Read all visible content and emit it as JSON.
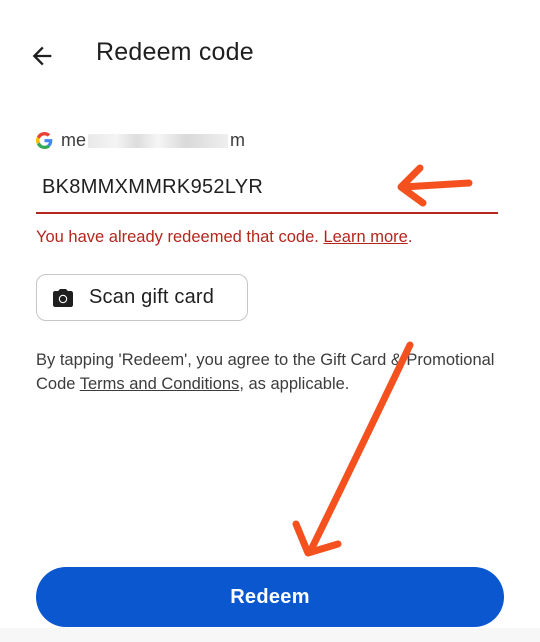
{
  "header": {
    "title": "Redeem code",
    "back_icon": "arrow-back-icon"
  },
  "account": {
    "email_prefix": "me",
    "email_suffix": "m",
    "logo": "google-g-icon"
  },
  "code_field": {
    "value": "BK8MMXMMRK952LYR",
    "underline_color": "#b3261e"
  },
  "error": {
    "message": "You have already redeemed that code. ",
    "link_label": "Learn more",
    "end": ".",
    "color": "#b3261e"
  },
  "scan": {
    "label": "Scan gift card",
    "icon": "camera-icon"
  },
  "terms": {
    "before": "By tapping 'Redeem', you agree to the Gift Card & Promotional Code ",
    "link_label": "Terms and Conditions",
    "after": ", as applicable."
  },
  "redeem": {
    "label": "Redeem",
    "color": "#0b57d0"
  },
  "annotations": {
    "arrow_color": "#f4511e",
    "arrow_1_icon": "arrow-left-annotation",
    "arrow_2_icon": "arrow-down-left-annotation"
  }
}
